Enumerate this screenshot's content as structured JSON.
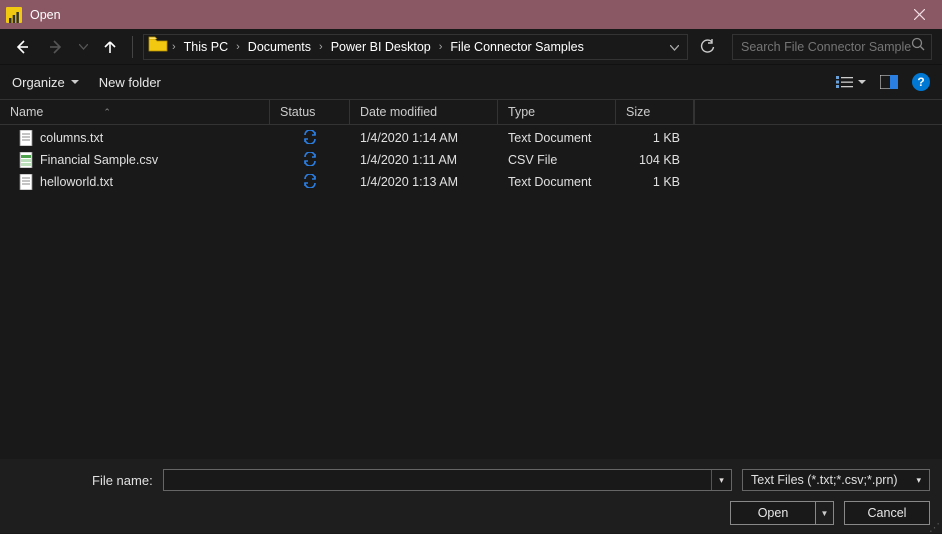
{
  "window": {
    "title": "Open"
  },
  "nav": {
    "breadcrumbs": [
      "This PC",
      "Documents",
      "Power BI Desktop",
      "File Connector Samples"
    ]
  },
  "search": {
    "placeholder": "Search File Connector Samples"
  },
  "toolbar": {
    "organize": "Organize",
    "new_folder": "New folder"
  },
  "columns": {
    "name": "Name",
    "status": "Status",
    "date": "Date modified",
    "type": "Type",
    "size": "Size"
  },
  "files": [
    {
      "icon": "txt",
      "name": "columns.txt",
      "date": "1/4/2020 1:14 AM",
      "type": "Text Document",
      "size": "1 KB"
    },
    {
      "icon": "csv",
      "name": "Financial Sample.csv",
      "date": "1/4/2020 1:11 AM",
      "type": "CSV File",
      "size": "104 KB"
    },
    {
      "icon": "txt",
      "name": "helloworld.txt",
      "date": "1/4/2020 1:13 AM",
      "type": "Text Document",
      "size": "1 KB"
    }
  ],
  "bottom": {
    "filename_label": "File name:",
    "filename_value": "",
    "filter": "Text Files (*.txt;*.csv;*.prn)",
    "open": "Open",
    "cancel": "Cancel"
  }
}
